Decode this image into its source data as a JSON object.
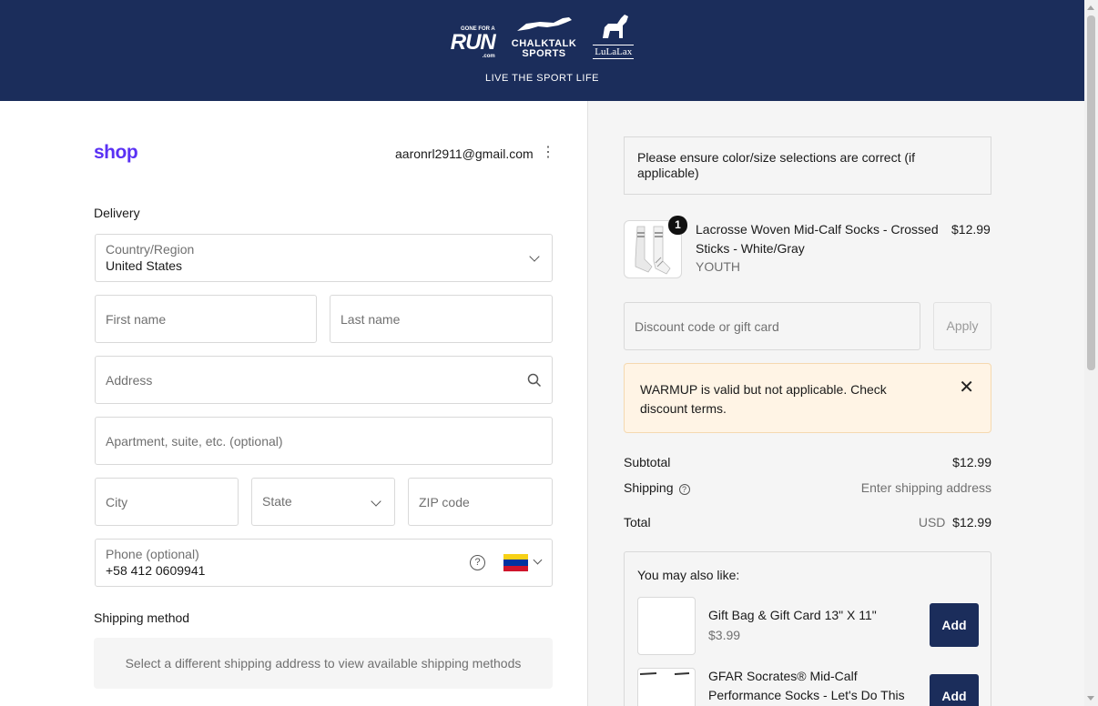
{
  "header": {
    "logo_run": "RUN",
    "logo_run_top": "GONE FOR A",
    "logo_run_suffix": ".com",
    "logo_chalktalk_1": "CHALKTALK",
    "logo_chalktalk_2": "SPORTS",
    "logo_lulalax": "LuLaLax",
    "tagline": "LIVE THE SPORT LIFE",
    "background": "#1b2d5b"
  },
  "account": {
    "brand": "shop",
    "brand_color": "#5a31f4",
    "email": "aaronrl2911@gmail.com",
    "menu_icon": "kebab-menu-icon"
  },
  "delivery": {
    "title": "Delivery",
    "country_label": "Country/Region",
    "country_value": "United States",
    "first_name_placeholder": "First name",
    "last_name_placeholder": "Last name",
    "address_placeholder": "Address",
    "apartment_placeholder": "Apartment, suite, etc. (optional)",
    "city_placeholder": "City",
    "state_placeholder": "State",
    "zip_placeholder": "ZIP code",
    "phone_label": "Phone (optional)",
    "phone_value": "+58 412 0609941",
    "phone_flag": "venezuela-flag"
  },
  "shipping_method": {
    "title": "Shipping method",
    "message": "Select a different shipping address to view available shipping methods"
  },
  "order": {
    "notice": "Please ensure color/size selections are correct (if applicable)",
    "item": {
      "quantity": "1",
      "name": "Lacrosse Woven Mid-Calf Socks - Crossed Sticks - White/Gray",
      "variant": "YOUTH",
      "price": "$12.99"
    },
    "discount_placeholder": "Discount code or gift card",
    "apply_label": "Apply",
    "warning": "WARMUP is valid but not applicable. Check discount terms.",
    "warning_bg": "#fff4e5",
    "subtotal_label": "Subtotal",
    "subtotal_value": "$12.99",
    "shipping_label": "Shipping",
    "shipping_value": "Enter shipping address",
    "total_label": "Total",
    "total_currency": "USD",
    "total_value": "$12.99"
  },
  "upsell": {
    "title": "You may also like:",
    "items": [
      {
        "name": "Gift Bag & Gift Card 13\" X 11\"",
        "price": "$3.99",
        "button": "Add"
      },
      {
        "name": "GFAR Socrates® Mid-Calf Performance Socks - Let's Do This",
        "price": "",
        "button": "Add"
      }
    ]
  }
}
